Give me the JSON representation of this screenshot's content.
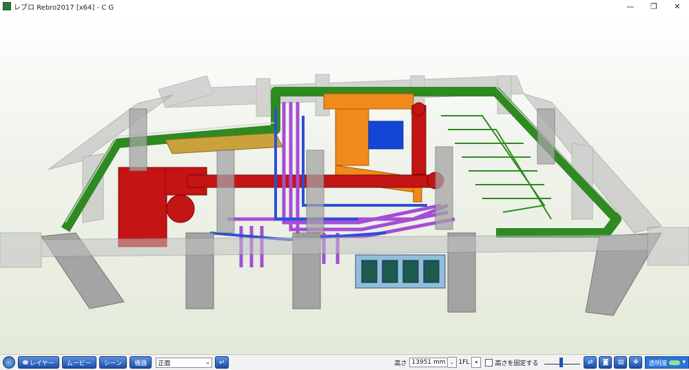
{
  "window": {
    "title": "レブロ Rebro2017 [x64] - C G",
    "minimize": "—",
    "maximize": "❐",
    "close": "✕"
  },
  "statusbar": {
    "layer_label": "レイヤー",
    "movie_label": "ムービー",
    "scene_label": "シーン",
    "equipment_label": "機器",
    "view_value": "正面",
    "enter_label": "↵",
    "height_label": "高さ",
    "height_value": "13951 mm",
    "floor_value": "1FL",
    "fix_height_label": "高さを固定する",
    "transparency_label": "透明度"
  },
  "icons": {
    "settings": "gear-icon",
    "layer": "layers-icon",
    "camera": "camera-icon",
    "printer": "printer-icon",
    "navigation": "compass-icon",
    "swap": "swap-arrows-icon"
  },
  "colors": {
    "frame_gray": "#a8a8a8",
    "cable_tray_green": "#2f8a21",
    "duct_red": "#c41414",
    "duct_orange": "#f08a1a",
    "ahu_blue": "#1446d6",
    "pipe_purple": "#a64cd8",
    "pipe_blue": "#2a4fd8",
    "ui_blue": "#1c4ea5"
  }
}
